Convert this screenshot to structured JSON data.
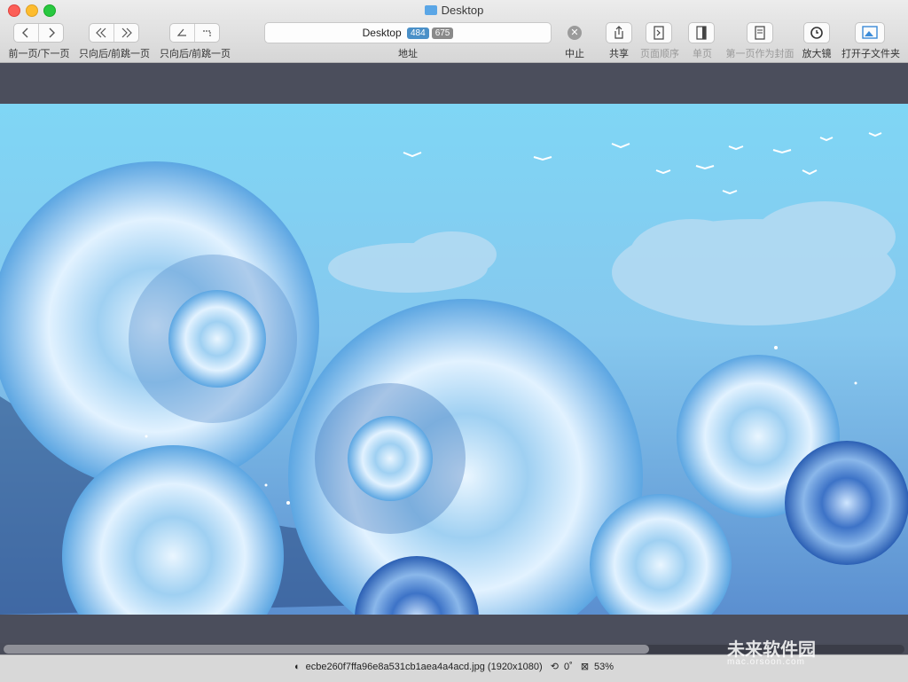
{
  "window": {
    "title": "Desktop"
  },
  "toolbar": {
    "nav_prev_next_label": "前一页/下一页",
    "nav_back_fwd_label_1": "只向后/前跳一页",
    "nav_back_fwd_label_2": "只向后/前跳一页",
    "address": {
      "text": "Desktop",
      "count_a": "484",
      "count_b": "675",
      "label": "地址"
    },
    "stop_label": "中止",
    "share_label": "共享",
    "page_order_label": "页面顺序",
    "single_page_label": "单页",
    "first_page_cover_label": "第一页作为封面",
    "magnifier_label": "放大镜",
    "open_subfolder_label": "打开子文件夹"
  },
  "status": {
    "filename": "ecbe260f7ffa96e8a531cb1aea4a4acd.jpg (1920x1080)",
    "rotation": "0˚",
    "zoom": "53%"
  },
  "scrollbar": {
    "position_fraction": 0.72
  },
  "watermark": {
    "text": "未来软件园",
    "url": "mac.orsoon.com"
  },
  "colors": {
    "accent": "#4a90c8",
    "sky": "#7fd3f2",
    "wave": "#3a8ed6"
  }
}
